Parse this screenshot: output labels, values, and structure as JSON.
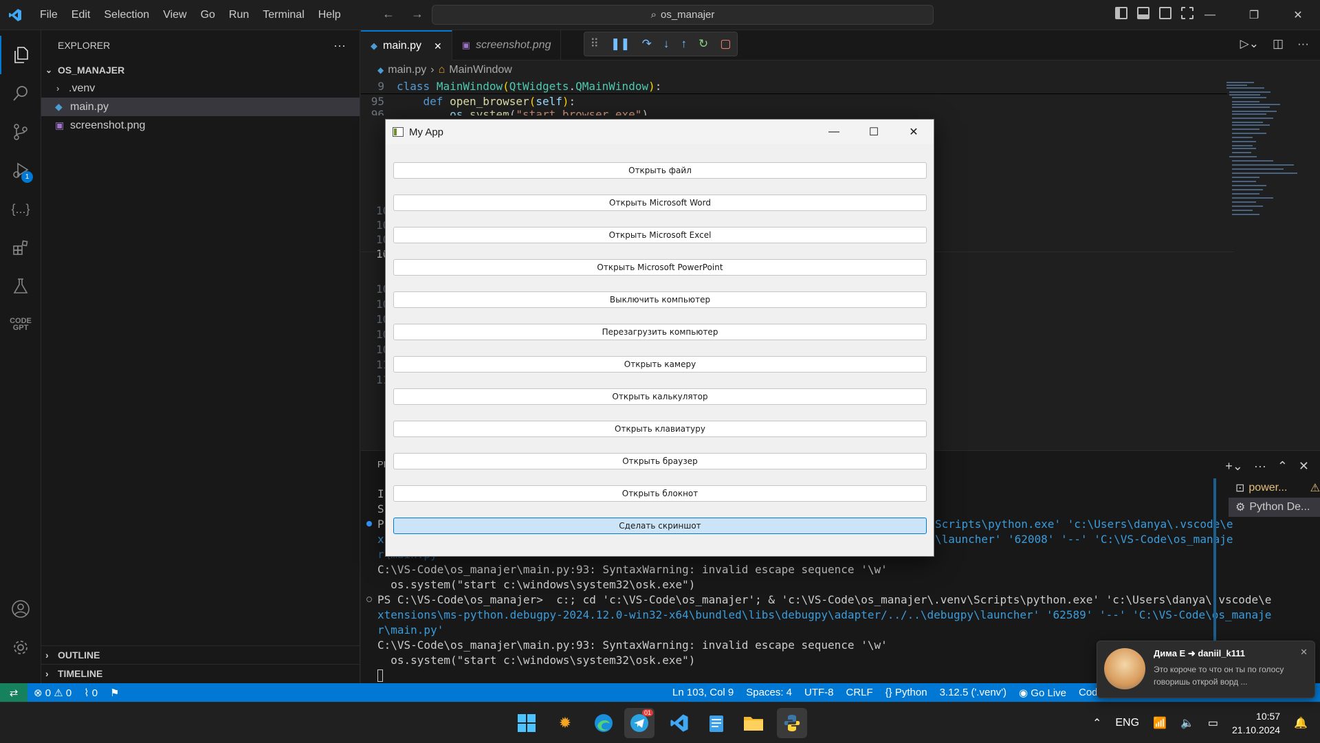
{
  "titlebar": {
    "menu": [
      "File",
      "Edit",
      "Selection",
      "View",
      "Go",
      "Run",
      "Terminal",
      "Help"
    ],
    "search": "os_manajer"
  },
  "activity": {
    "debug_badge": "1"
  },
  "sidebar": {
    "title": "EXPLORER",
    "folder": "OS_MANAJER",
    "items": [
      ".venv",
      "main.py",
      "screenshot.png"
    ],
    "outline": "OUTLINE",
    "timeline": "TIMELINE"
  },
  "editor": {
    "tabs": [
      {
        "label": "main.py",
        "active": true
      },
      {
        "label": "screenshot.png",
        "active": false
      }
    ],
    "breadcrumb": {
      "file": "main.py",
      "symbol": "MainWindow"
    },
    "lines": [
      {
        "num": "9",
        "code": "class MainWindow(QtWidgets.QMainWindow):"
      },
      {
        "num": "95",
        "code": "    def open_browser(self):"
      },
      {
        "num": "96",
        "code": "        os.system(\"start browser.exe\")"
      }
    ],
    "partial_line_numbers": [
      "10",
      "10",
      "10",
      "10",
      "10",
      "10",
      "10",
      "10",
      "10",
      "11",
      "11"
    ]
  },
  "panel": {
    "terminal_lines": [
      "I",
      "S",
      "P",
      "x",
      "r\\main.py",
      "C:\\VS-Code\\os_manajer\\main.py:93: SyntaxWarning: invalid escape sequence '\\w'",
      "  os.system(\"start c:\\windows\\system32\\osk.exe\")",
      "PS C:\\VS-Code\\os_manajer>  c:; cd 'c:\\VS-Code\\os_manajer'; & 'c:\\VS-Code\\os_manajer\\.venv\\Scripts\\python.exe' 'c:\\Users\\danya\\.vscode\\e",
      "xtensions\\ms-python.debugpy-2024.12.0-win32-x64\\bundled\\libs\\debugpy\\adapter/../..\\debugpy\\launcher' '62589' '--' 'C:\\VS-Code\\os_manaje",
      "r\\main.py'",
      "C:\\VS-Code\\os_manajer\\main.py:93: SyntaxWarning: invalid escape sequence '\\w'",
      "  os.system(\"start c:\\windows\\system32\\osk.exe\")"
    ],
    "line3_right": "Scripts\\python.exe' 'c:\\Users\\danya\\.vscode\\e",
    "line4_right": "\\launcher' '62008' '--' 'C:\\VS-Code\\os_manaje",
    "terminals": [
      "power...",
      "Python De..."
    ],
    "tab_partial": "PI"
  },
  "statusbar": {
    "errors": "0",
    "warnings": "0",
    "ports": "0",
    "position": "Ln 103, Col 9",
    "spaces": "Spaces: 4",
    "encoding": "UTF-8",
    "eol": "CRLF",
    "language": "Python",
    "interpreter": "3.12.5 ('.venv')",
    "golive": "Go Live",
    "codeium": "Codeium (Pre-R"
  },
  "app": {
    "title": "My App",
    "buttons": [
      "Открыть файл",
      "Открыть Microsoft Word",
      "Открыть Microsoft Excel",
      "Открыть Microsoft PowerPoint",
      "Выключить компьютер",
      "Перезагрузить компьютер",
      "Открыть камеру",
      "Открыть калькулятор",
      "Открыть клавиатуру",
      "Открыть браузер",
      "Открыть блокнот",
      "Сделать скриншот"
    ]
  },
  "notification": {
    "from": "Дима Е ➜ daniil_k111",
    "message": "Это короче то что он ты по голосу говоришь открой ворд ..."
  },
  "taskbar": {
    "telegram_badge": "01",
    "language": "ENG",
    "time": "10:57",
    "date": "21.10.2024"
  },
  "colors": {
    "accent": "#0078d4",
    "statusbar": "#0078d4",
    "remote": "#16825d"
  }
}
